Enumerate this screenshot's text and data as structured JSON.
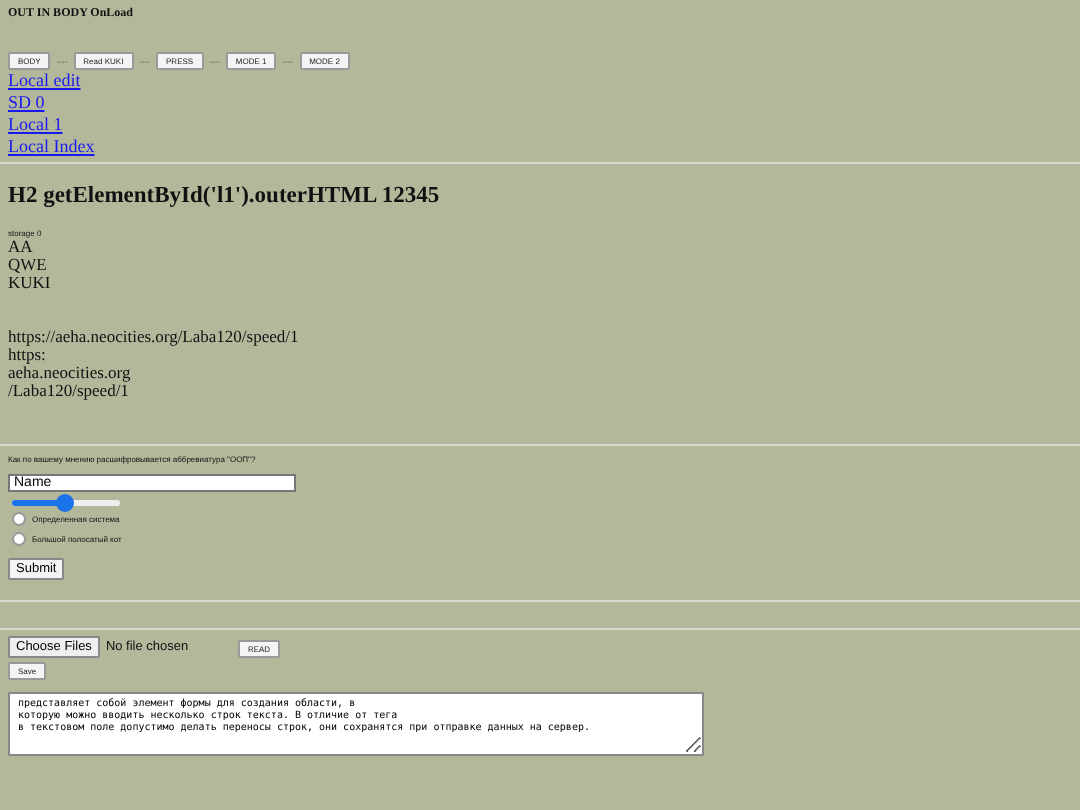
{
  "title": "OUT IN BODY OnLoad",
  "toolbar": [
    {
      "label": "BODY",
      "sep": "----"
    },
    {
      "label": "Read KUKI",
      "sep": "----"
    },
    {
      "label": "PRESS",
      "sep": "----"
    },
    {
      "label": "MODE 1",
      "sep": "----"
    },
    {
      "label": "MODE 2"
    }
  ],
  "links": [
    "Local edit",
    "SD 0",
    "Local 1",
    "Local Index"
  ],
  "heading": "H2 getElementById('l1').outerHTML 12345",
  "storage_label": "storage 0",
  "storage_lines": [
    "AA",
    "QWE",
    "KUKI"
  ],
  "url_lines": [
    "https://aeha.neocities.org/Laba120/speed/1",
    "https:",
    "aeha.neocities.org",
    "/Laba120/speed/1"
  ],
  "form": {
    "question": "Как по вашему мнению расшифровывается аббревиатура \"ООП\"?",
    "name_value": "Name",
    "slider": {
      "level": 0.5
    },
    "options": [
      {
        "label": "Определенная система",
        "selected": false
      },
      {
        "label": "Большой полосатый кот",
        "selected": false
      }
    ],
    "submit": "Submit"
  },
  "file": {
    "button": "Choose Files",
    "status": "No file chosen",
    "read": "READ",
    "save": "Save"
  },
  "textarea": "представляет собой элемент формы для создания области, в\nкоторую можно вводить несколько строк текста. В отличие от тега\nв текстовом поле допустимо делать переносы строк, они сохранятся при отправке данных на сервер."
}
